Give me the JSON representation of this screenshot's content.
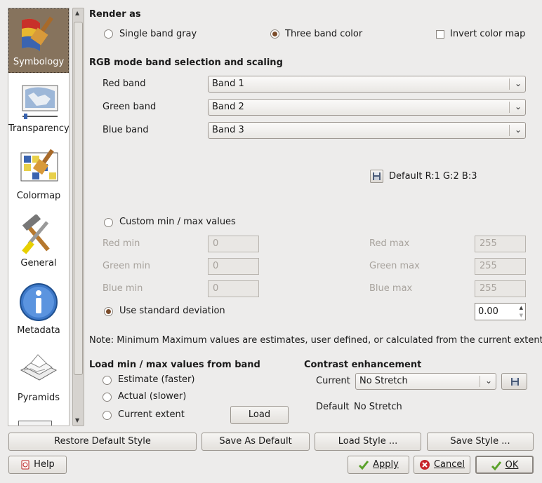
{
  "sidebar": {
    "items": [
      {
        "label": "Symbology",
        "icon": "paintbrush-icon"
      },
      {
        "label": "Transparency",
        "icon": "map-slider-icon"
      },
      {
        "label": "Colormap",
        "icon": "colormap-icon"
      },
      {
        "label": "General",
        "icon": "tools-icon"
      },
      {
        "label": "Metadata",
        "icon": "info-icon"
      },
      {
        "label": "Pyramids",
        "icon": "pyramids-icon"
      }
    ]
  },
  "render": {
    "title": "Render as",
    "single_band": "Single band gray",
    "three_band": "Three band color",
    "invert": "Invert color map",
    "selected": "three_band"
  },
  "rgb": {
    "title": "RGB mode band selection and scaling",
    "red_label": "Red band",
    "red_value": "Band 1",
    "green_label": "Green band",
    "green_value": "Band 2",
    "blue_label": "Blue band",
    "blue_value": "Band 3",
    "default_text": "Default R:1 G:2 B:3"
  },
  "minmax": {
    "custom_label": "Custom min / max values",
    "red_min_label": "Red min",
    "red_min": "0",
    "green_min_label": "Green min",
    "green_min": "0",
    "blue_min_label": "Blue min",
    "blue_min": "0",
    "red_max_label": "Red max",
    "red_max": "255",
    "green_max_label": "Green max",
    "green_max": "255",
    "blue_max_label": "Blue max",
    "blue_max": "255",
    "stddev_label": "Use standard deviation",
    "stddev_value": "0.00",
    "note": "Note: Minimum Maximum values are estimates, user defined, or calculated from the current extent"
  },
  "load": {
    "title": "Load min / max values from band",
    "estimate": "Estimate (faster)",
    "actual": "Actual (slower)",
    "current_extent": "Current extent",
    "load_button": "Load"
  },
  "contrast": {
    "title": "Contrast enhancement",
    "current_label": "Current",
    "current_value": "No Stretch",
    "default_label": "Default",
    "default_value": "No Stretch"
  },
  "style_buttons": {
    "restore": "Restore Default Style",
    "save_default": "Save As Default",
    "load_style": "Load Style ...",
    "save_style": "Save Style ..."
  },
  "dialog_buttons": {
    "help": "Help",
    "apply": "Apply",
    "cancel": "Cancel",
    "ok": "OK"
  },
  "colors": {
    "selected_bg": "#86735d",
    "radio_dot": "#7a4b2a",
    "ok_check": "#5aa12a",
    "cancel_red": "#c7242a"
  }
}
